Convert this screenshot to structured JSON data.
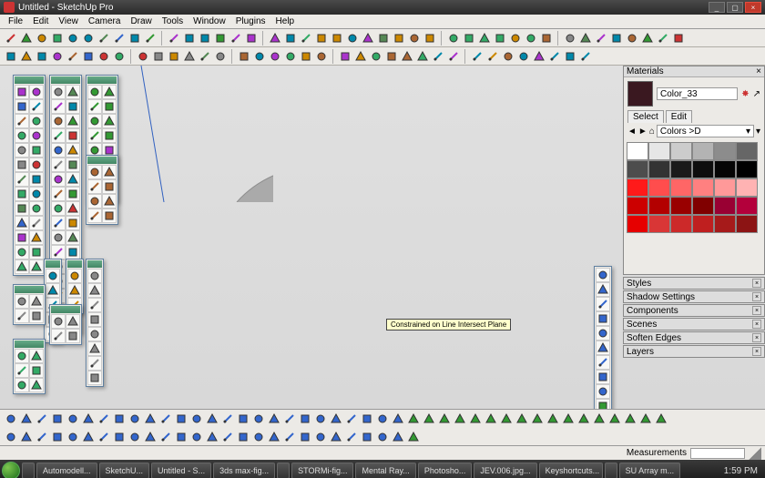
{
  "window": {
    "title": "Untitled - SketchUp Pro"
  },
  "winbtns": {
    "min": "_",
    "max": "▢",
    "close": "×"
  },
  "menu": [
    "File",
    "Edit",
    "View",
    "Camera",
    "Draw",
    "Tools",
    "Window",
    "Plugins",
    "Help"
  ],
  "toolbars": {
    "row1a": [
      "new",
      "open",
      "save",
      "cut",
      "copy",
      "paste",
      "undo",
      "redo",
      "print",
      "model-info"
    ],
    "row1b": [
      "iso",
      "top",
      "front",
      "right",
      "back",
      "left"
    ],
    "row1c": [
      "render",
      "render-rt",
      "options",
      "batch",
      "stop",
      "frame",
      "sun",
      "material",
      "light",
      "dome",
      "export"
    ],
    "row1d": [
      "anim-play",
      "anim-stop",
      "anim-prev",
      "anim-next",
      "keyframe",
      "cam",
      "cam-add"
    ],
    "row1e": [
      "a",
      "b",
      "c",
      "d",
      "e",
      "f",
      "g",
      "h"
    ],
    "row2a": [
      "select",
      "eraser",
      "paint",
      "line",
      "arc",
      "rect",
      "circle",
      "poly"
    ],
    "row2b": [
      "dim",
      "text",
      "3dtext",
      "section",
      "axes",
      "tape"
    ],
    "row2c": [
      "pushpull",
      "move",
      "rotate",
      "scale",
      "offset",
      "followme"
    ],
    "row2d": [
      "orbit",
      "pan",
      "zoom",
      "zoom-ext",
      "zoom-win",
      "prev",
      "walk",
      "look"
    ],
    "row2e": [
      "shadow",
      "fog",
      "xray",
      "wire",
      "hidden",
      "mono",
      "tex",
      "styles"
    ]
  },
  "materials": {
    "title": "Materials",
    "current_name": "Color_33",
    "tabs": [
      "Select",
      "Edit"
    ],
    "lib_label": "Colors >D",
    "nav": {
      "home": "⌂",
      "back": "◄",
      "fwd": "►",
      "detail": "▾"
    },
    "swatches": [
      "#ffffff",
      "#e6e6e6",
      "#cccccc",
      "#b3b3b3",
      "#8c8c8c",
      "#666666",
      "#4d4d4d",
      "#333333",
      "#1a1a1a",
      "#0d0d0d",
      "#050505",
      "#000000",
      "#ff1a1a",
      "#ff4d4d",
      "#ff6666",
      "#ff8080",
      "#ff9999",
      "#ffb3b3",
      "#cc0000",
      "#b30000",
      "#990000",
      "#800000",
      "#990033",
      "#b3003b",
      "#e60000",
      "#d93636",
      "#cc2929",
      "#bf1f1f",
      "#a61a1a",
      "#8c1414"
    ]
  },
  "right_panels": [
    {
      "title": "Styles"
    },
    {
      "title": "Shadow Settings"
    },
    {
      "title": "Components"
    },
    {
      "title": "Scenes"
    },
    {
      "title": "Soften Edges"
    },
    {
      "title": "Layers"
    }
  ],
  "viewport": {
    "tooltip": "Constrained on Line Intersect Plane"
  },
  "floating_palettes": {
    "p_a": [
      "sel",
      "line",
      "rect",
      "circ",
      "arc",
      "poly",
      "free",
      "erase",
      "tape",
      "prot",
      "text",
      "dim",
      "axes",
      "paint",
      "push",
      "move",
      "rot",
      "scale",
      "off",
      "follow",
      "orbit",
      "pan",
      "zoom",
      "zext",
      "zwin",
      "prev"
    ],
    "p_b": [
      "a",
      "b",
      "c",
      "d",
      "e",
      "f",
      "g",
      "h",
      "i",
      "j",
      "k",
      "l",
      "m",
      "n",
      "o",
      "p",
      "q",
      "r",
      "s",
      "t",
      "u",
      "v",
      "w",
      "x",
      "y",
      "z",
      "aa",
      "bb",
      "cc",
      "dd",
      "ee",
      "ff",
      "gg"
    ],
    "p_c": [
      "s1",
      "s2",
      "s3",
      "s4",
      "s5",
      "s6",
      "s7",
      "s8",
      "s9",
      "s10",
      "s11",
      "s12",
      "s13",
      "s14",
      "s15",
      "s16"
    ],
    "p_e": [
      "g1",
      "g2",
      "g3",
      "g4",
      "g5"
    ],
    "p_f": [
      "x1",
      "x2",
      "x3",
      "x4",
      "x5",
      "x6",
      "x7",
      "x8"
    ],
    "p_g": [
      "n1",
      "n2",
      "n3",
      "n4"
    ],
    "p_h": [
      "r1",
      "r2",
      "r3",
      "r4",
      "r5",
      "r6",
      "r7",
      "r8"
    ],
    "p_i": [
      "w1",
      "w2",
      "w3"
    ],
    "p_j": [
      "t1",
      "t2",
      "t3",
      "t4",
      "t5",
      "t6"
    ],
    "vert": [
      "v1",
      "v2",
      "v3",
      "v4",
      "v5",
      "v6",
      "v7",
      "v8",
      "v9",
      "v10",
      "v11"
    ]
  },
  "bottom_rows": {
    "r1": [
      "a",
      "b",
      "c",
      "d",
      "e",
      "f",
      "g",
      "h",
      "i",
      "j",
      "k",
      "l",
      "m",
      "n",
      "o",
      "p",
      "q",
      "r",
      "s",
      "t",
      "u",
      "v",
      "w",
      "x",
      "y",
      "z",
      "a2",
      "b2",
      "c2",
      "d2",
      "e2",
      "f2",
      "g2",
      "h2",
      "i2",
      "j2",
      "k2",
      "l2",
      "m2",
      "n2",
      "o2",
      "p2",
      "q2"
    ],
    "r2": [
      "a",
      "b",
      "c",
      "d",
      "e",
      "f",
      "g",
      "h",
      "i",
      "j",
      "k",
      "l",
      "m",
      "n",
      "o",
      "p",
      "q",
      "r",
      "s",
      "t",
      "u",
      "v",
      "w",
      "x",
      "y",
      "z",
      "a2"
    ]
  },
  "statusbar": {
    "meas_label": "Measurements"
  },
  "taskbar": {
    "items": [
      "",
      "Automodell...",
      "SketchU...",
      "Untitled - S...",
      "3ds max-fig...",
      "",
      "STORMi-fig...",
      "Mental Ray...",
      "Photosho...",
      "JEV.006.jpg...",
      "Keyshortcuts...",
      "",
      "SU Array m..."
    ],
    "clock": "1:59 PM"
  },
  "icon_colors": [
    "#3a6",
    "#c33",
    "#36c",
    "#c80",
    "#888",
    "#585",
    "#a3c",
    "#08a",
    "#a63",
    "#393"
  ]
}
